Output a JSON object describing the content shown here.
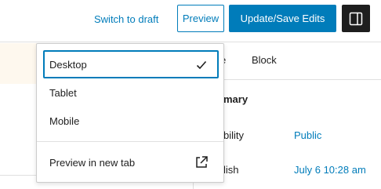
{
  "header": {
    "switch_to_draft": "Switch to draft",
    "preview": "Preview",
    "update_save": "Update/Save Edits"
  },
  "sidebar": {
    "tab_post_partial": "e",
    "tab_block": "Block",
    "summary_partial": "mary",
    "visibility_label_partial": "bility",
    "visibility_value": "Public",
    "publish_label_partial": "lish",
    "publish_value": "July 6 10:28 am"
  },
  "preview_menu": {
    "items": [
      {
        "label": "Desktop",
        "selected": true
      },
      {
        "label": "Tablet",
        "selected": false
      },
      {
        "label": "Mobile",
        "selected": false
      }
    ],
    "new_tab_label": "Preview in new tab",
    "selected_icon": "checkmark-icon",
    "new_tab_icon": "external-link-icon"
  },
  "colors": {
    "accent": "#007cba",
    "dark": "#1e1e1e",
    "notice_bg": "#fef8ee"
  }
}
